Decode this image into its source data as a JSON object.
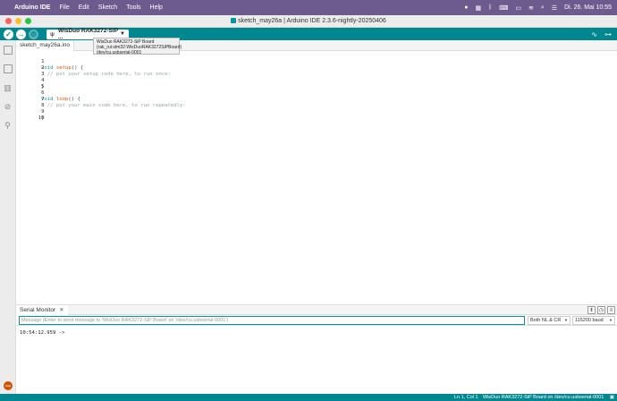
{
  "menubar": {
    "apple": "",
    "app_name": "Arduino IDE",
    "menus": [
      "File",
      "Edit",
      "Sketch",
      "Tools",
      "Help"
    ],
    "datetime": "Di. 26. Mai  10:55"
  },
  "window": {
    "title": "sketch_may26a | Arduino IDE 2.3.6-nightly-20250406"
  },
  "toolbar": {
    "board": "WisDuo RAK3272-SiP ...",
    "tooltip_lines": [
      "WisDuo RAK3272-SiP Board",
      "(rak_rui:stm32:WisDuoRAK3272SiPBoard)",
      "/dev/cu.usbserial-0001"
    ]
  },
  "editor": {
    "tab_name": "sketch_may26a.ino",
    "lines": [
      {
        "n": "1",
        "text": "void setup() {"
      },
      {
        "n": "2",
        "text": "  // put your setup code here, to run once:"
      },
      {
        "n": "3",
        "text": ""
      },
      {
        "n": "4",
        "text": "}"
      },
      {
        "n": "5",
        "text": ""
      },
      {
        "n": "6",
        "text": "void loop() {"
      },
      {
        "n": "7",
        "text": "  // put your main code here, to run repeatedly:"
      },
      {
        "n": "8",
        "text": ""
      },
      {
        "n": "9",
        "text": "}"
      },
      {
        "n": "10",
        "text": ""
      }
    ]
  },
  "serial": {
    "tab_label": "Serial Monitor",
    "input_placeholder": "Message (Enter to send message to 'WisDuo RAK3272-SiP Board' on '/dev/cu.usbserial-0001')",
    "line_ending": "Both NL & CR",
    "baud": "115200 baud",
    "output": "10:54:12.959 ->"
  },
  "statusbar": {
    "position": "Ln 1, Col 1",
    "board": "WisDuo RAK3272-SiP Board on /dev/cu.usbserial-0001"
  },
  "colors": {
    "accent": "#00878f",
    "menubar": "#6d5a8e"
  }
}
